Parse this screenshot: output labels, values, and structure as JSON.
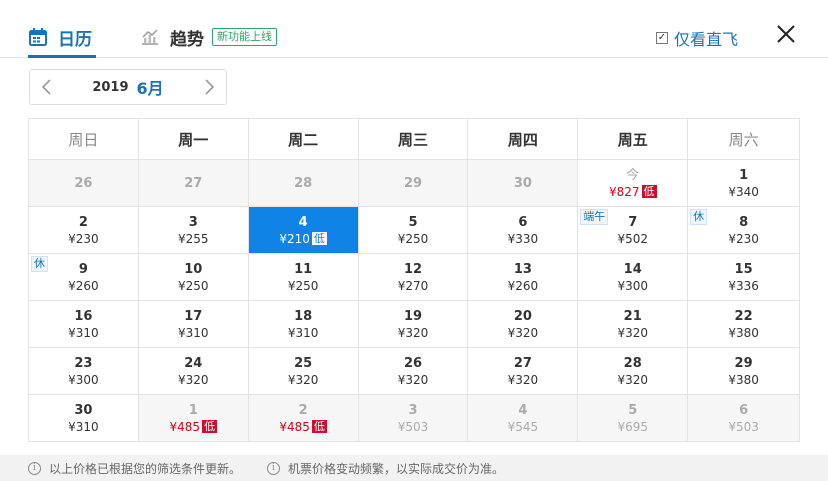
{
  "header": {
    "tabs": [
      {
        "label": "日历",
        "icon": "calendar-icon",
        "active": true
      },
      {
        "label": "趋势",
        "icon": "trend-chart-icon",
        "active": false
      }
    ],
    "new_badge": "新功能上线",
    "direct_label": "仅看直飞",
    "direct_checked": true,
    "close_icon": "close-icon"
  },
  "nav": {
    "year": "2019",
    "month": "6月",
    "prev_icon": "chevron-left-icon",
    "next_icon": "chevron-right-icon"
  },
  "calendar": {
    "weekdays": [
      "周日",
      "周一",
      "周二",
      "周三",
      "周四",
      "周五",
      "周六"
    ],
    "weeks": [
      [
        {
          "day": "26",
          "price": "",
          "muted": true
        },
        {
          "day": "27",
          "price": "",
          "muted": true
        },
        {
          "day": "28",
          "price": "",
          "muted": true
        },
        {
          "day": "29",
          "price": "",
          "muted": true
        },
        {
          "day": "30",
          "price": "",
          "muted": true
        },
        {
          "day": "今",
          "price": "¥827",
          "low": "低",
          "today": true,
          "red": true
        },
        {
          "day": "1",
          "price": "¥340"
        }
      ],
      [
        {
          "day": "2",
          "price": "¥230"
        },
        {
          "day": "3",
          "price": "¥255"
        },
        {
          "day": "4",
          "price": "¥210",
          "low": "低",
          "selected": true
        },
        {
          "day": "5",
          "price": "¥250"
        },
        {
          "day": "6",
          "price": "¥330"
        },
        {
          "day": "7",
          "price": "¥502",
          "tag": "端午"
        },
        {
          "day": "8",
          "price": "¥230",
          "tag": "休"
        }
      ],
      [
        {
          "day": "9",
          "price": "¥260",
          "tag": "休"
        },
        {
          "day": "10",
          "price": "¥250"
        },
        {
          "day": "11",
          "price": "¥250"
        },
        {
          "day": "12",
          "price": "¥270"
        },
        {
          "day": "13",
          "price": "¥260"
        },
        {
          "day": "14",
          "price": "¥300"
        },
        {
          "day": "15",
          "price": "¥336"
        }
      ],
      [
        {
          "day": "16",
          "price": "¥310"
        },
        {
          "day": "17",
          "price": "¥310"
        },
        {
          "day": "18",
          "price": "¥310"
        },
        {
          "day": "19",
          "price": "¥320"
        },
        {
          "day": "20",
          "price": "¥320"
        },
        {
          "day": "21",
          "price": "¥320"
        },
        {
          "day": "22",
          "price": "¥380"
        }
      ],
      [
        {
          "day": "23",
          "price": "¥300"
        },
        {
          "day": "24",
          "price": "¥320"
        },
        {
          "day": "25",
          "price": "¥320"
        },
        {
          "day": "26",
          "price": "¥320"
        },
        {
          "day": "27",
          "price": "¥320"
        },
        {
          "day": "28",
          "price": "¥320"
        },
        {
          "day": "29",
          "price": "¥380"
        }
      ],
      [
        {
          "day": "30",
          "price": "¥310"
        },
        {
          "day": "1",
          "price": "¥485",
          "low": "低",
          "muted": true,
          "red": true
        },
        {
          "day": "2",
          "price": "¥485",
          "low": "低",
          "muted": true,
          "red": true
        },
        {
          "day": "3",
          "price": "¥503",
          "muted": true
        },
        {
          "day": "4",
          "price": "¥545",
          "muted": true
        },
        {
          "day": "5",
          "price": "¥695",
          "muted": true
        },
        {
          "day": "6",
          "price": "¥503",
          "muted": true
        }
      ]
    ]
  },
  "footer": {
    "notes": [
      "以上价格已根据您的筛选条件更新。",
      "机票价格变动频繁，以实际成交价为准。"
    ],
    "info_icon": "info-icon"
  },
  "colors": {
    "accent": "#1a73b5",
    "selected_bg": "#0f84e6",
    "low_badge": "#c8102e",
    "red_price": "#d0021b",
    "new_badge": "#2aa66a"
  }
}
